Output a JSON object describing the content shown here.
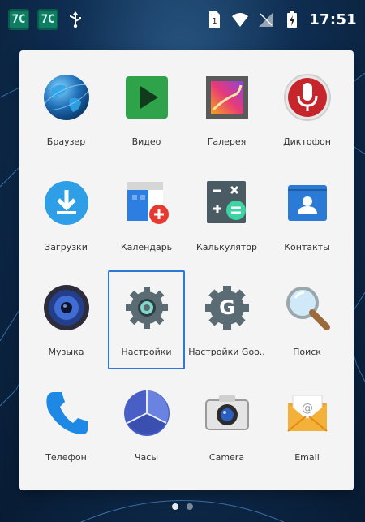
{
  "status_bar": {
    "left_icons": [
      "7C",
      "7C",
      "usb-icon"
    ],
    "right_icons": [
      "sim-icon",
      "wifi-icon",
      "signal-icon",
      "battery-icon"
    ],
    "time": "17:51"
  },
  "apps": [
    {
      "label": "Браузер",
      "icon": "globe-icon"
    },
    {
      "label": "Видео",
      "icon": "video-icon"
    },
    {
      "label": "Галерея",
      "icon": "gallery-icon"
    },
    {
      "label": "Диктофон",
      "icon": "microphone-icon"
    },
    {
      "label": "Загрузки",
      "icon": "download-icon"
    },
    {
      "label": "Календарь",
      "icon": "calendar-icon"
    },
    {
      "label": "Калькулятор",
      "icon": "calculator-icon"
    },
    {
      "label": "Контакты",
      "icon": "contacts-icon"
    },
    {
      "label": "Музыка",
      "icon": "music-icon"
    },
    {
      "label": "Настройки",
      "icon": "settings-gear-icon"
    },
    {
      "label": "Настройки Goo..",
      "icon": "google-settings-icon"
    },
    {
      "label": "Поиск",
      "icon": "search-icon"
    },
    {
      "label": "Телефон",
      "icon": "phone-icon"
    },
    {
      "label": "Часы",
      "icon": "clock-icon"
    },
    {
      "label": "Camera",
      "icon": "camera-icon"
    },
    {
      "label": "Email",
      "icon": "email-icon"
    }
  ],
  "selected_app": "Настройки",
  "page_indicator": {
    "pages": 2,
    "current": 1
  },
  "colors": {
    "selection_border": "#2b78d8",
    "drawer_bg": "#f4f4f4",
    "terminal_icon": "#0f7c64"
  }
}
